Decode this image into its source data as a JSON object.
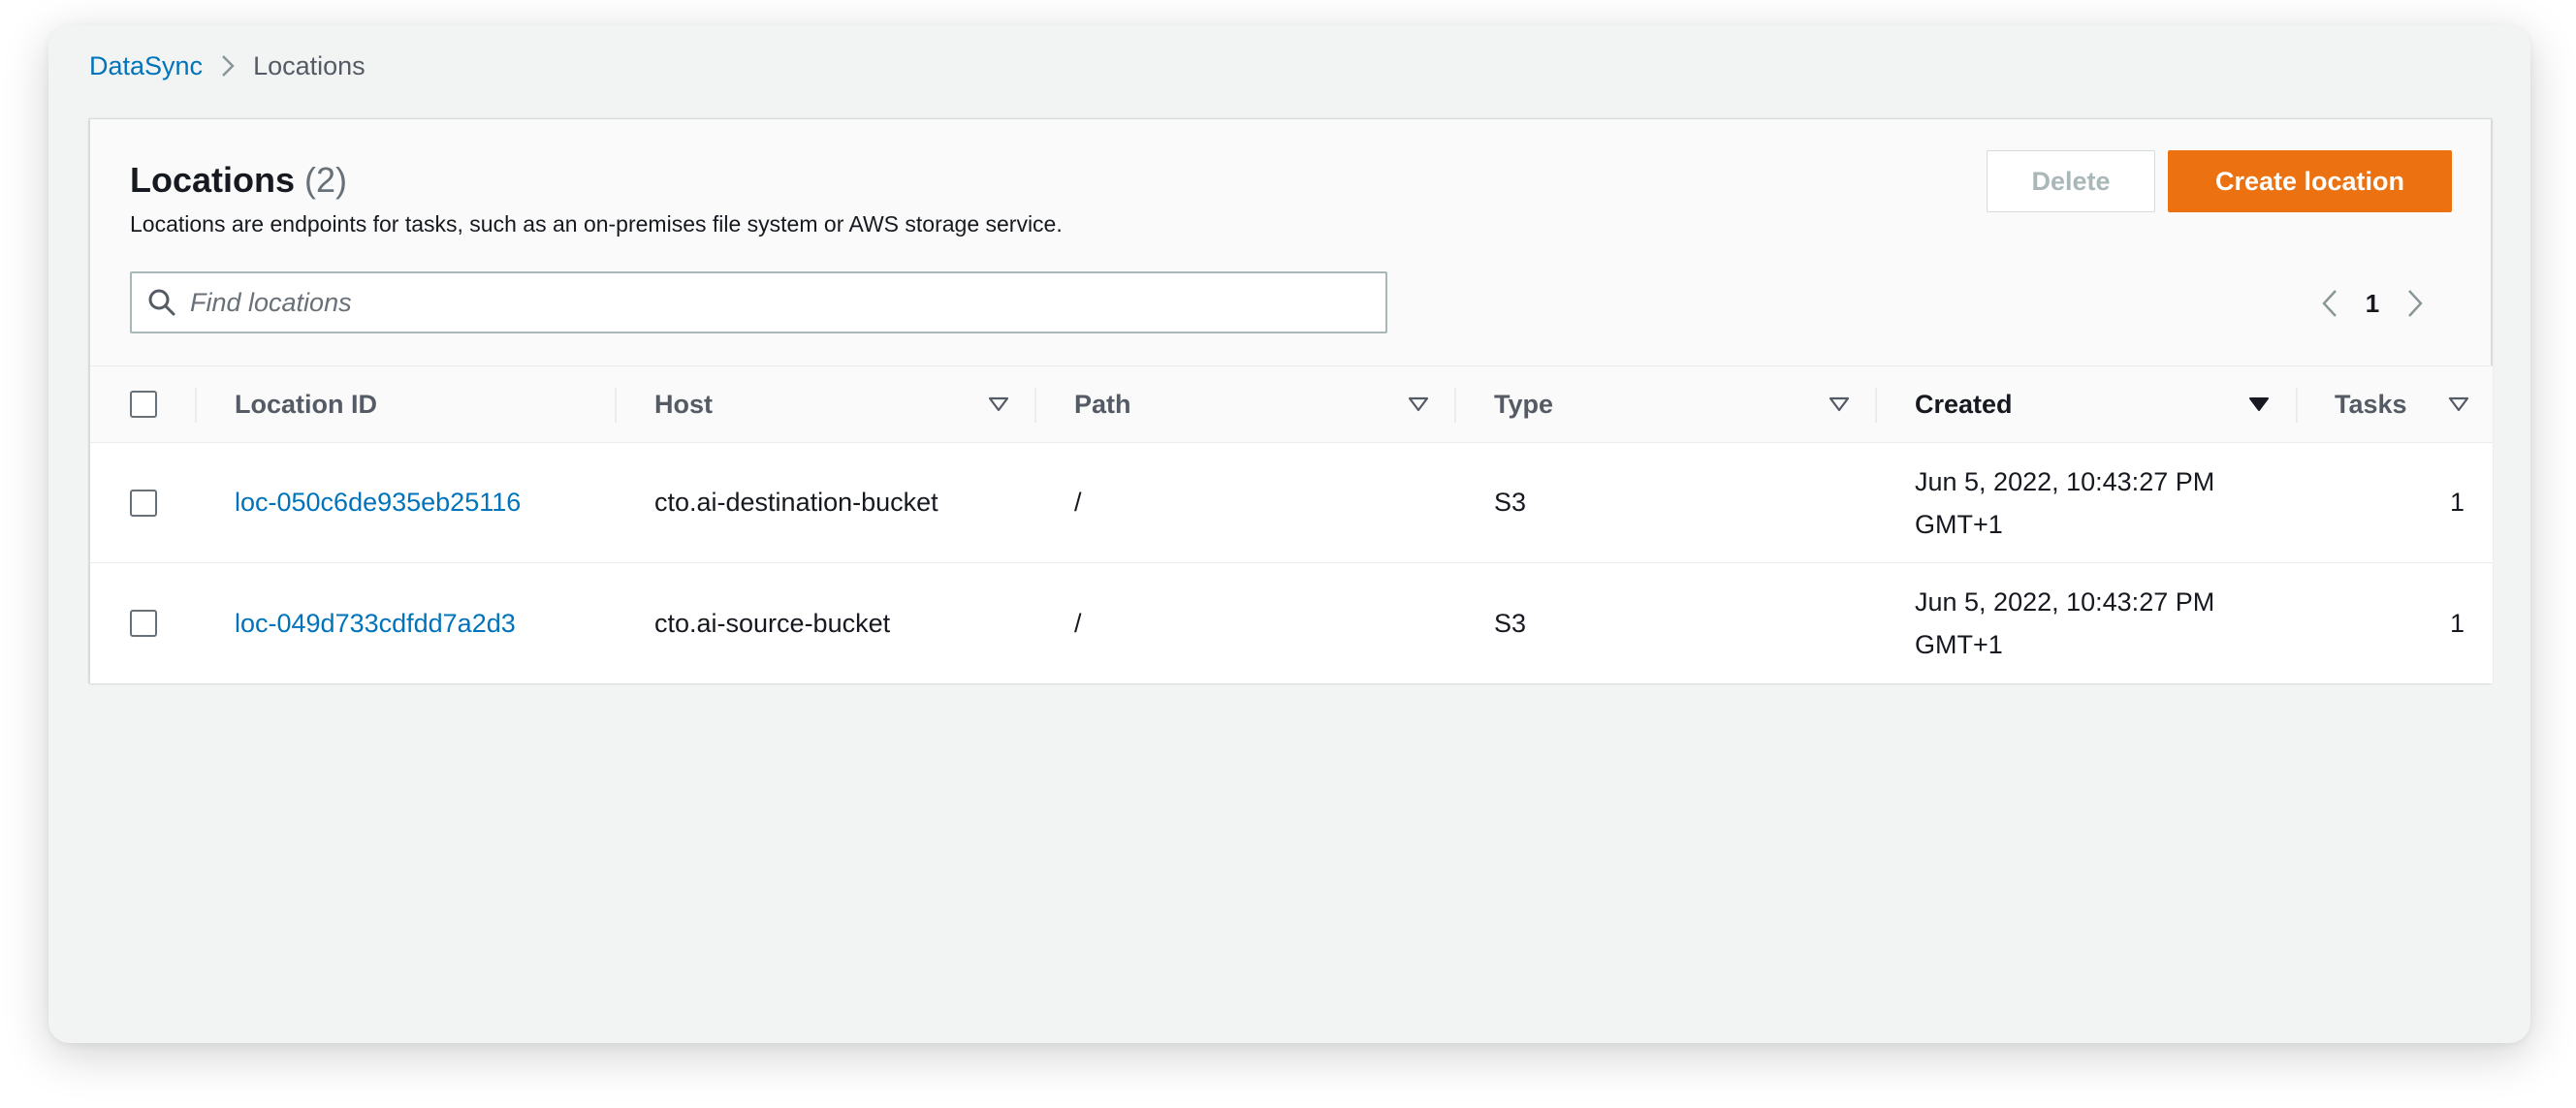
{
  "breadcrumb": {
    "parent": "DataSync",
    "current": "Locations"
  },
  "header": {
    "title": "Locations",
    "count": "(2)",
    "description": "Locations are endpoints for tasks, such as an on-premises file system or AWS storage service."
  },
  "actions": {
    "delete_label": "Delete",
    "create_label": "Create location"
  },
  "search": {
    "placeholder": "Find locations"
  },
  "pagination": {
    "current_page": "1"
  },
  "columns": [
    "Location ID",
    "Host",
    "Path",
    "Type",
    "Created",
    "Tasks"
  ],
  "sorted_column": "Created",
  "rows": [
    {
      "location_id": "loc-050c6de935eb25116",
      "host": "cto.ai-destination-bucket",
      "path": "/",
      "type": "S3",
      "created_line1": "Jun 5, 2022, 10:43:27 PM",
      "created_line2": "GMT+1",
      "tasks": "1"
    },
    {
      "location_id": "loc-049d733cdfdd7a2d3",
      "host": "cto.ai-source-bucket",
      "path": "/",
      "type": "S3",
      "created_line1": "Jun 5, 2022, 10:43:27 PM",
      "created_line2": "GMT+1",
      "tasks": "1"
    }
  ],
  "colors": {
    "link": "#0073bb",
    "primary_button": "#ec7211",
    "background": "#f2f3f3"
  },
  "icons": [
    "chevron-right-icon",
    "search-icon",
    "chevron-left-icon",
    "sort-icon",
    "sort-descending-icon"
  ]
}
